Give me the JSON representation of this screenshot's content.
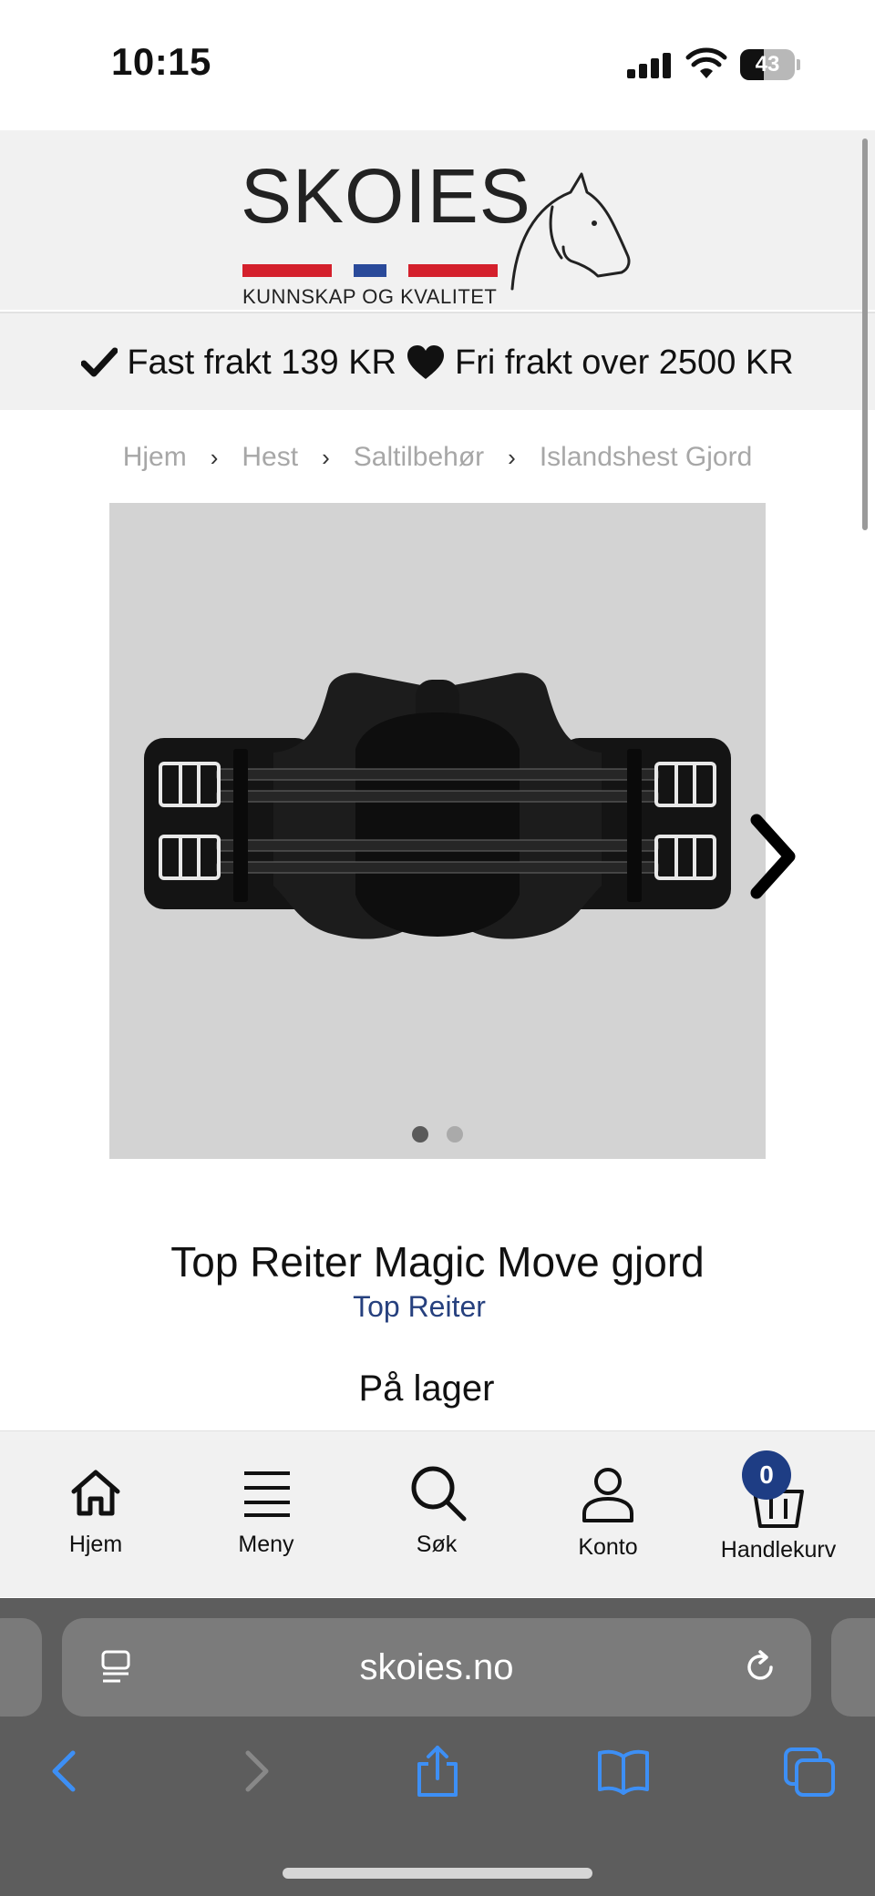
{
  "status_bar": {
    "time": "10:15",
    "battery_level": "43"
  },
  "header": {
    "logo_word": "SKOIES",
    "logo_tagline": "KUNNSKAP OG KVALITET",
    "logo_colors": {
      "red": "#d4202c",
      "blue": "#2a4a9a"
    }
  },
  "shipping": {
    "text_1": "Fast frakt 139 KR",
    "text_2": "Fri frakt over 2500 KR",
    "icon_1": "checkmark-icon",
    "icon_2": "heart-icon"
  },
  "breadcrumb": {
    "items": [
      "Hjem",
      "Hest",
      "Saltilbehør",
      "Islandshest Gjord"
    ]
  },
  "gallery": {
    "image_count": 2,
    "active_index": 0
  },
  "product": {
    "title": "Top Reiter Magic Move gjord",
    "brand": "Top Reiter",
    "stock_status": "På lager"
  },
  "bottom_nav": {
    "items": [
      {
        "label": "Hjem",
        "icon": "home-icon"
      },
      {
        "label": "Meny",
        "icon": "menu-icon"
      },
      {
        "label": "Søk",
        "icon": "search-icon"
      },
      {
        "label": "Konto",
        "icon": "account-icon"
      },
      {
        "label": "Handlekurv",
        "icon": "cart-icon"
      }
    ],
    "cart_count": "0"
  },
  "browser": {
    "url": "skoies.no"
  },
  "colors": {
    "brand_blue": "#26407e",
    "badge": "#1e3d84",
    "ios_blue": "#3d8ff5"
  }
}
